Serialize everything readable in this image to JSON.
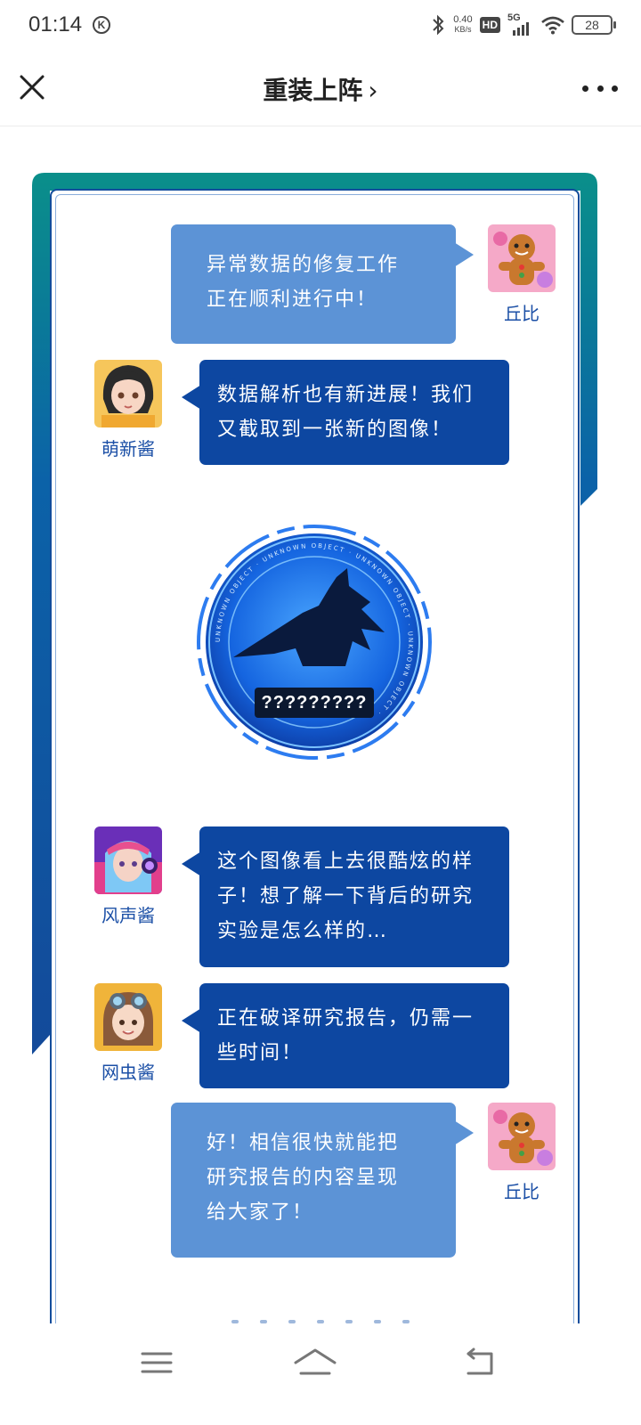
{
  "status_bar": {
    "time": "01:14",
    "k_badge": "K",
    "net_speed_value": "0.40",
    "net_speed_unit": "KB/s",
    "hd": "HD",
    "network": "5G",
    "battery": "28"
  },
  "header": {
    "title": "重装上阵",
    "title_chevron": "›"
  },
  "chat": [
    {
      "speaker": "丘比",
      "side": "right",
      "style": "light",
      "lines": [
        "异常数据的修复工作",
        "正在顺利进行中！"
      ]
    },
    {
      "speaker": "萌新酱",
      "side": "left",
      "style": "dark",
      "lines": [
        "数据解析也有新进展！我们",
        "又截取到一张新的图像！"
      ]
    },
    {
      "speaker": "风声酱",
      "side": "left",
      "style": "dark",
      "lines": [
        "这个图像看上去很酷炫的样",
        "子！想了解一下背后的研究",
        "实验是怎么样的…"
      ]
    },
    {
      "speaker": "网虫酱",
      "side": "left",
      "style": "dark",
      "lines": [
        "正在破译研究报告，仍需一",
        "些时间！"
      ]
    },
    {
      "speaker": "丘比",
      "side": "right",
      "style": "light",
      "lines": [
        "好！相信很快就能把",
        "研究报告的内容呈现",
        "给大家了！"
      ]
    }
  ],
  "emblem": {
    "label": "?????????",
    "ring_text": "UNKNOWN OBJECT · UNKNOWN OBJECT · UNKNOWN OBJECT · UNKNOWN OBJECT ·"
  },
  "colors": {
    "accent_dark": "#0d47a1",
    "accent_light": "#5c93d6",
    "frame_teal": "#0a8f8a",
    "frame_blue": "#124d9c"
  }
}
